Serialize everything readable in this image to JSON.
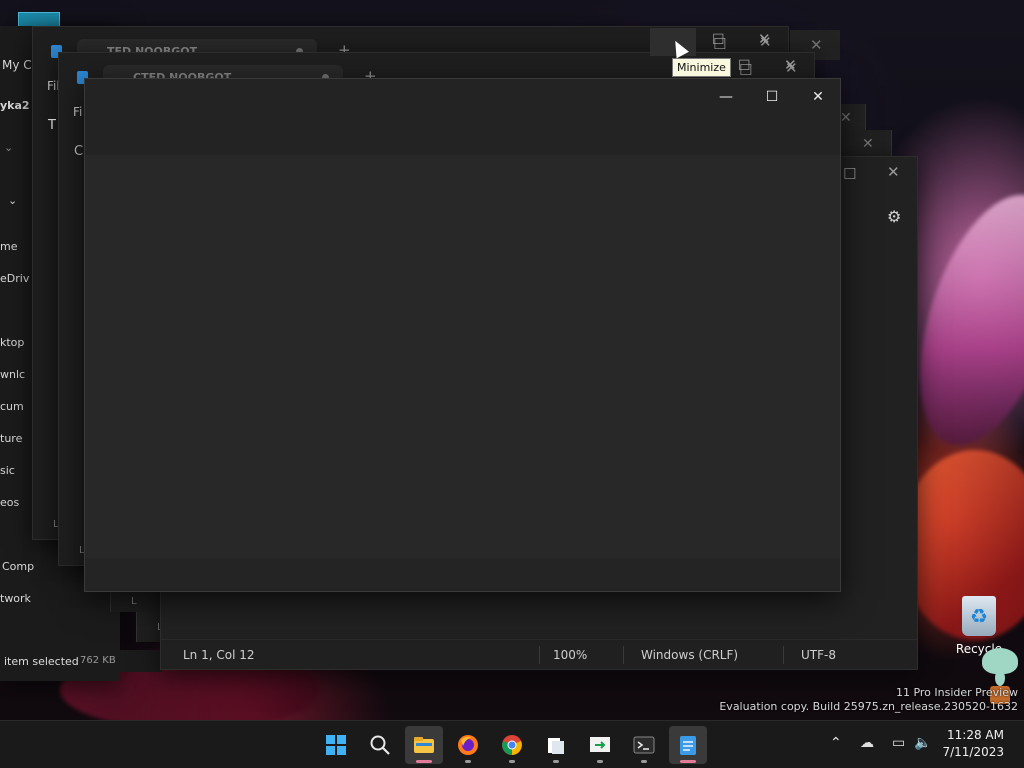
{
  "explorer": {
    "title_partial": "My C",
    "user_partial": "yka2",
    "nav": [
      "me",
      "eDriv",
      "ktop",
      "wnlc",
      "cum",
      "ture",
      "sic",
      "eos",
      "Comp",
      "twork"
    ],
    "status": "item selected",
    "size": "762 KB"
  },
  "notepad_windows": {
    "tab1": "TED NOOBGOT",
    "tab2": "CTED NOOBGOT",
    "menu1": "Fil",
    "menu2": "Fi",
    "partial_t": "T",
    "partial_c": "C",
    "line_marker": "L"
  },
  "statusbar": {
    "position": "Ln 1, Col 12",
    "zoom": "100%",
    "line_ending": "Windows (CRLF)",
    "encoding": "UTF-8"
  },
  "tooltip": "Minimize",
  "desktop": {
    "recycle_label": "Recycle",
    "watermark_line1": "11 Pro Insider Preview",
    "watermark_line2": "Evaluation copy. Build 25975.zn_release.230520-1632"
  },
  "taskbar": {
    "apps": [
      "start-icon",
      "search-icon",
      "file-explorer-icon",
      "firefox-icon",
      "chrome-icon",
      "files-icon",
      "remote-icon",
      "terminal-icon",
      "notepad-icon"
    ]
  },
  "clock": {
    "time": "11:28 AM",
    "date": "7/11/2023"
  }
}
